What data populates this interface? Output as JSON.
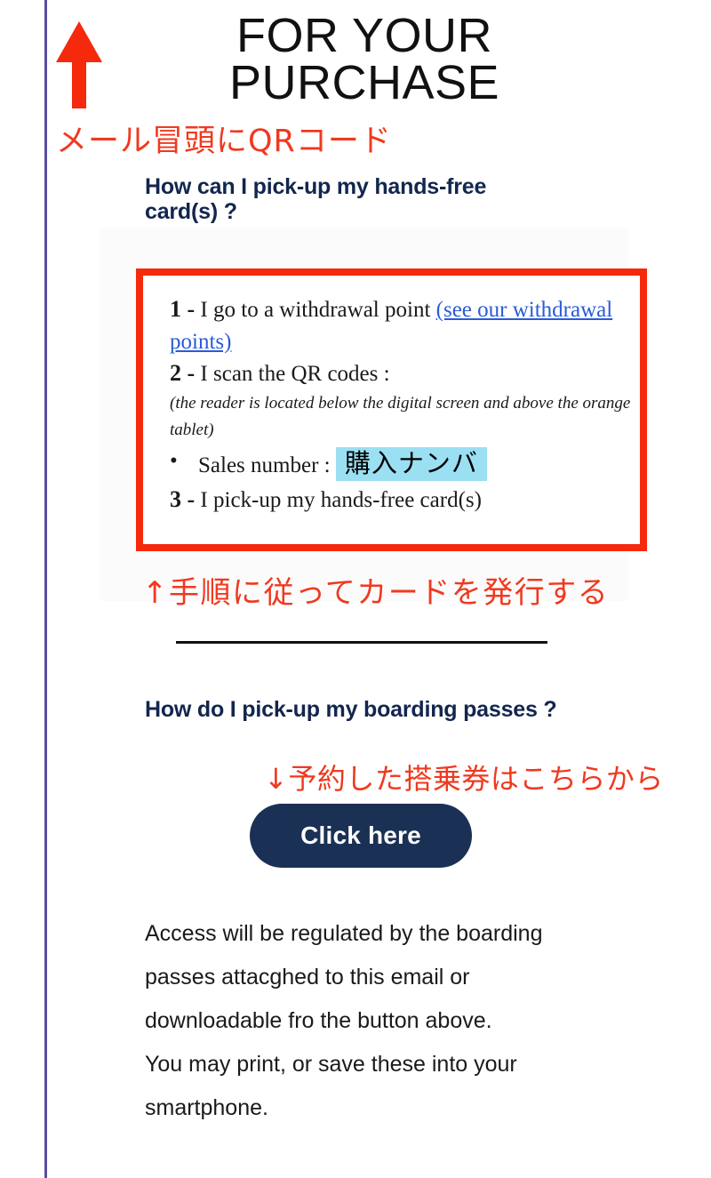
{
  "page": {
    "title": "FOR YOUR\nPURCHASE",
    "accent_red": "#F5290C",
    "annotation_red": "#F0391F",
    "navy": "#12264E",
    "link_blue": "#2A5BD7",
    "highlight_cyan": "#9BDFF2",
    "left_rule_purple": "#5B4B9E"
  },
  "annotations": {
    "qr_note": "メール冒頭にQRコード",
    "steps_note": "↑手順に従ってカードを発行する",
    "boarding_note": "↓予約した搭乗券はこちらから"
  },
  "sections": {
    "pickup_card": {
      "heading": "How can I pick-up my hands-free card(s) ?",
      "steps": {
        "step1_num": "1 -",
        "step1_text": "I go to a withdrawal point",
        "step1_link": "(see our withdrawal points)",
        "step2_num": "2 -",
        "step2_text": "I scan the QR codes :",
        "step2_note": "(the reader is located below the digital screen and above the orange tablet)",
        "bullet_marker": "•",
        "bullet_label": "Sales number :",
        "bullet_highlight": "購入ナンバ",
        "step3_num": "3 -",
        "step3_text": "I pick-up my hands-free card(s)"
      }
    },
    "boarding_passes": {
      "heading": "How do I pick-up my boarding passes ?",
      "cta_label": "Click here",
      "body_line1": "Access will be regulated by the boarding passes attacghed to this email or downloadable fro the button above.",
      "body_line2": "You may print, or save these into your smartphone."
    }
  }
}
